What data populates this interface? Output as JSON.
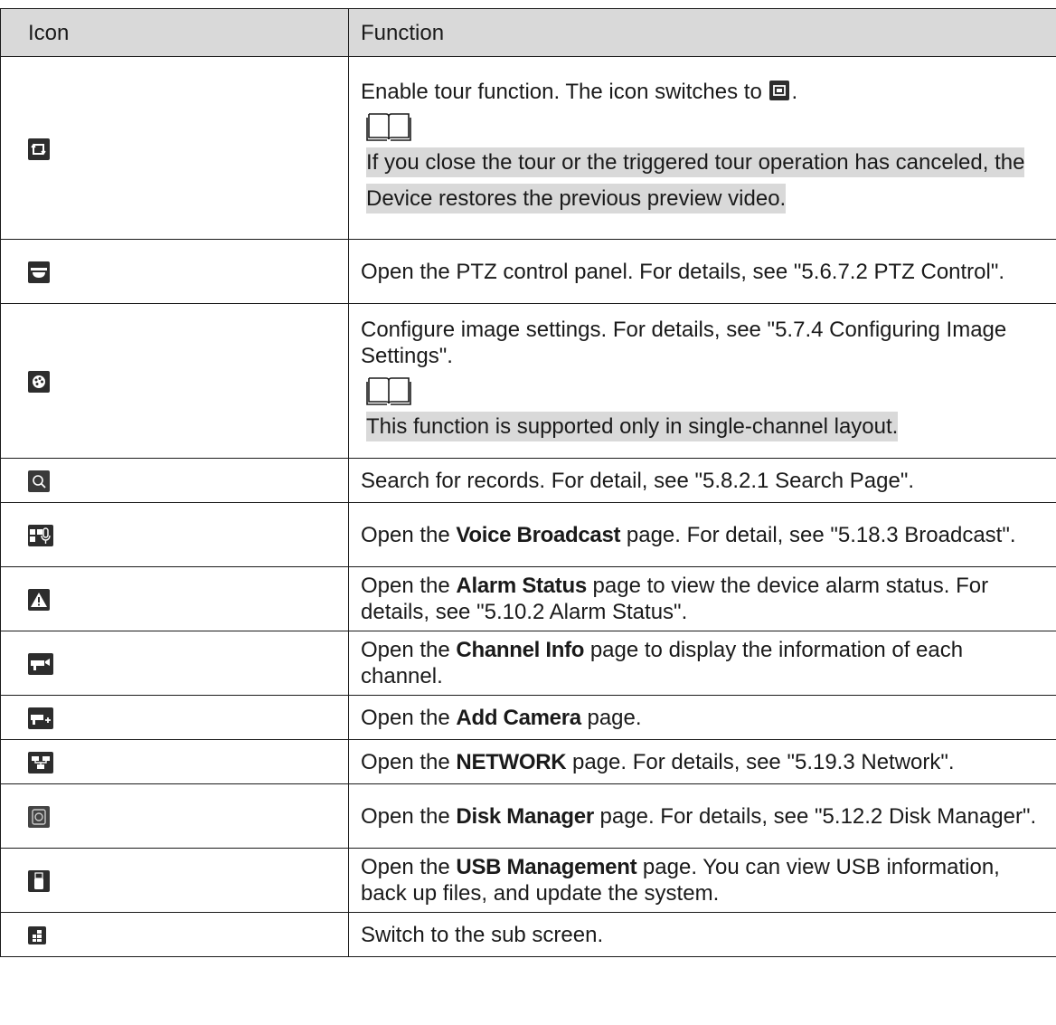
{
  "headers": {
    "icon": "Icon",
    "function": "Function"
  },
  "rows": [
    {
      "icon": "tour-icon",
      "text": "Enable tour function. The icon switches to ",
      "text_after": ".",
      "note": "If you close the tour or the triggered tour operation has canceled, the Device restores the previous preview video."
    },
    {
      "icon": "ptz-icon",
      "text": "Open the PTZ control panel. For details, see \"5.6.7.2 PTZ Control\"."
    },
    {
      "icon": "image-settings-icon",
      "text": "Configure image settings. For details, see \"5.7.4 Configuring Image Settings\".",
      "note": "This function is supported only in single-channel layout."
    },
    {
      "icon": "search-icon",
      "text": "Search for records. For detail, see \"5.8.2.1 Search Page\"."
    },
    {
      "icon": "voice-broadcast-icon",
      "pre": "Open the ",
      "bold": "Voice Broadcast",
      "post": " page. For detail, see \"5.18.3 Broadcast\"."
    },
    {
      "icon": "alarm-status-icon",
      "pre": "Open the ",
      "bold": "Alarm Status",
      "post": " page to view the device alarm status. For details, see \"5.10.2 Alarm Status\"."
    },
    {
      "icon": "channel-info-icon",
      "pre": "Open the ",
      "bold": "Channel Info",
      "post": " page to display the information of each channel."
    },
    {
      "icon": "add-camera-icon",
      "pre": "Open the ",
      "bold": "Add Camera",
      "post": " page."
    },
    {
      "icon": "network-icon",
      "pre": "Open the ",
      "bold": "NETWORK",
      "post": " page. For details, see \"5.19.3 Network\"."
    },
    {
      "icon": "disk-manager-icon",
      "pre": "Open the ",
      "bold": "Disk Manager",
      "post": " page. For details, see \"5.12.2 Disk Manager\"."
    },
    {
      "icon": "usb-management-icon",
      "pre": "Open the ",
      "bold": "USB Management",
      "post": " page. You can view USB information, back up files, and update the system."
    },
    {
      "icon": "sub-screen-icon",
      "text": "Switch to the sub screen."
    }
  ]
}
